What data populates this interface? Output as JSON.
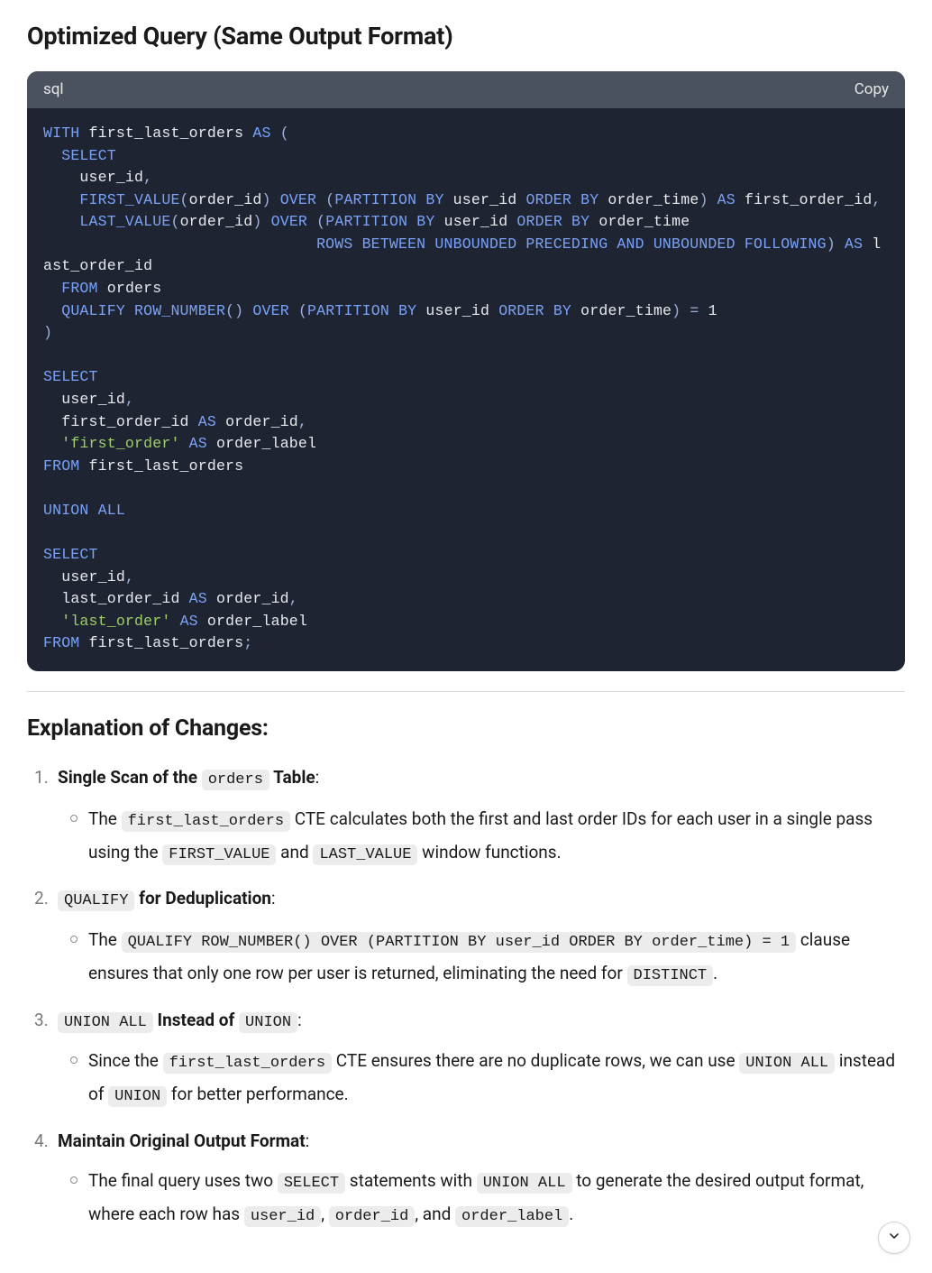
{
  "section_title": "Optimized Query (Same Output Format)",
  "code": {
    "language": "sql",
    "copy_label": "Copy",
    "tokens": [
      [
        [
          "kw",
          "WITH"
        ],
        [
          "id",
          " first_last_orders "
        ],
        [
          "kw",
          "AS"
        ],
        [
          "id",
          " "
        ],
        [
          "punc",
          "("
        ]
      ],
      [
        [
          "id",
          "  "
        ],
        [
          "kw",
          "SELECT"
        ]
      ],
      [
        [
          "id",
          "    user_id"
        ],
        [
          "punc",
          ","
        ]
      ],
      [
        [
          "id",
          "    "
        ],
        [
          "kw",
          "FIRST_VALUE"
        ],
        [
          "punc",
          "("
        ],
        [
          "id",
          "order_id"
        ],
        [
          "punc",
          ")"
        ],
        [
          "id",
          " "
        ],
        [
          "kw",
          "OVER"
        ],
        [
          "id",
          " "
        ],
        [
          "punc",
          "("
        ],
        [
          "kw",
          "PARTITION BY"
        ],
        [
          "id",
          " user_id "
        ],
        [
          "kw",
          "ORDER BY"
        ],
        [
          "id",
          " order_time"
        ],
        [
          "punc",
          ")"
        ],
        [
          "id",
          " "
        ],
        [
          "kw",
          "AS"
        ],
        [
          "id",
          " first_order_id"
        ],
        [
          "punc",
          ","
        ]
      ],
      [
        [
          "id",
          "    "
        ],
        [
          "kw",
          "LAST_VALUE"
        ],
        [
          "punc",
          "("
        ],
        [
          "id",
          "order_id"
        ],
        [
          "punc",
          ")"
        ],
        [
          "id",
          " "
        ],
        [
          "kw",
          "OVER"
        ],
        [
          "id",
          " "
        ],
        [
          "punc",
          "("
        ],
        [
          "kw",
          "PARTITION BY"
        ],
        [
          "id",
          " user_id "
        ],
        [
          "kw",
          "ORDER BY"
        ],
        [
          "id",
          " order_time"
        ]
      ],
      [
        [
          "id",
          "                              "
        ],
        [
          "kw",
          "ROWS BETWEEN UNBOUNDED PRECEDING AND UNBOUNDED FOLLOWING"
        ],
        [
          "punc",
          ")"
        ],
        [
          "id",
          " "
        ],
        [
          "kw",
          "AS"
        ],
        [
          "id",
          " last_order_id"
        ]
      ],
      [
        [
          "id",
          "  "
        ],
        [
          "kw",
          "FROM"
        ],
        [
          "id",
          " orders"
        ]
      ],
      [
        [
          "id",
          "  "
        ],
        [
          "kw",
          "QUALIFY"
        ],
        [
          "id",
          " "
        ],
        [
          "kw",
          "ROW_NUMBER"
        ],
        [
          "punc",
          "()"
        ],
        [
          "id",
          " "
        ],
        [
          "kw",
          "OVER"
        ],
        [
          "id",
          " "
        ],
        [
          "punc",
          "("
        ],
        [
          "kw",
          "PARTITION BY"
        ],
        [
          "id",
          " user_id "
        ],
        [
          "kw",
          "ORDER BY"
        ],
        [
          "id",
          " order_time"
        ],
        [
          "punc",
          ")"
        ],
        [
          "id",
          " "
        ],
        [
          "punc",
          "="
        ],
        [
          "id",
          " "
        ],
        [
          "num",
          "1"
        ]
      ],
      [
        [
          "punc",
          ")"
        ]
      ],
      [
        [
          "id",
          ""
        ]
      ],
      [
        [
          "kw",
          "SELECT"
        ]
      ],
      [
        [
          "id",
          "  user_id"
        ],
        [
          "punc",
          ","
        ]
      ],
      [
        [
          "id",
          "  first_order_id "
        ],
        [
          "kw",
          "AS"
        ],
        [
          "id",
          " order_id"
        ],
        [
          "punc",
          ","
        ]
      ],
      [
        [
          "id",
          "  "
        ],
        [
          "str",
          "'first_order'"
        ],
        [
          "id",
          " "
        ],
        [
          "kw",
          "AS"
        ],
        [
          "id",
          " order_label"
        ]
      ],
      [
        [
          "kw",
          "FROM"
        ],
        [
          "id",
          " first_last_orders"
        ]
      ],
      [
        [
          "id",
          ""
        ]
      ],
      [
        [
          "kw",
          "UNION ALL"
        ]
      ],
      [
        [
          "id",
          ""
        ]
      ],
      [
        [
          "kw",
          "SELECT"
        ]
      ],
      [
        [
          "id",
          "  user_id"
        ],
        [
          "punc",
          ","
        ]
      ],
      [
        [
          "id",
          "  last_order_id "
        ],
        [
          "kw",
          "AS "
        ],
        [
          "id",
          "order_id"
        ],
        [
          "punc",
          ","
        ]
      ],
      [
        [
          "id",
          "  "
        ],
        [
          "str",
          "'last_order'"
        ],
        [
          "id",
          " "
        ],
        [
          "kw",
          "AS"
        ],
        [
          "id",
          " order_label"
        ]
      ],
      [
        [
          "kw",
          "FROM"
        ],
        [
          "id",
          " first_last_orders"
        ],
        [
          "punc",
          ";"
        ]
      ]
    ]
  },
  "explanation_title": "Explanation of Changes:",
  "changes": [
    {
      "headline_parts": [
        {
          "kind": "bold",
          "text": "Single Scan of the "
        },
        {
          "kind": "code",
          "text": "orders"
        },
        {
          "kind": "bold",
          "text": " Table"
        },
        {
          "kind": "plain",
          "text": ":"
        }
      ],
      "bullets": [
        [
          {
            "kind": "plain",
            "text": "The "
          },
          {
            "kind": "code",
            "text": "first_last_orders"
          },
          {
            "kind": "plain",
            "text": " CTE calculates both the first and last order IDs for each user in a single pass using the "
          },
          {
            "kind": "code",
            "text": "FIRST_VALUE"
          },
          {
            "kind": "plain",
            "text": " and "
          },
          {
            "kind": "code",
            "text": "LAST_VALUE"
          },
          {
            "kind": "plain",
            "text": " window functions."
          }
        ]
      ]
    },
    {
      "headline_parts": [
        {
          "kind": "code",
          "text": "QUALIFY"
        },
        {
          "kind": "bold",
          "text": " for Deduplication"
        },
        {
          "kind": "plain",
          "text": ":"
        }
      ],
      "bullets": [
        [
          {
            "kind": "plain",
            "text": "The "
          },
          {
            "kind": "code",
            "text": "QUALIFY ROW_NUMBER() OVER (PARTITION BY user_id ORDER BY order_time) = 1"
          },
          {
            "kind": "plain",
            "text": " clause ensures that only one row per user is returned, eliminating the need for "
          },
          {
            "kind": "code",
            "text": "DISTINCT"
          },
          {
            "kind": "plain",
            "text": "."
          }
        ]
      ]
    },
    {
      "headline_parts": [
        {
          "kind": "code",
          "text": "UNION ALL"
        },
        {
          "kind": "bold",
          "text": " Instead of "
        },
        {
          "kind": "code",
          "text": "UNION"
        },
        {
          "kind": "plain",
          "text": ":"
        }
      ],
      "bullets": [
        [
          {
            "kind": "plain",
            "text": "Since the "
          },
          {
            "kind": "code",
            "text": "first_last_orders"
          },
          {
            "kind": "plain",
            "text": " CTE ensures there are no duplicate rows, we can use "
          },
          {
            "kind": "code",
            "text": "UNION ALL"
          },
          {
            "kind": "plain",
            "text": " instead of "
          },
          {
            "kind": "code",
            "text": "UNION"
          },
          {
            "kind": "plain",
            "text": " for better performance."
          }
        ]
      ]
    },
    {
      "headline_parts": [
        {
          "kind": "bold",
          "text": "Maintain Original Output Format"
        },
        {
          "kind": "plain",
          "text": ":"
        }
      ],
      "bullets": [
        [
          {
            "kind": "plain",
            "text": "The final query uses two "
          },
          {
            "kind": "code",
            "text": "SELECT"
          },
          {
            "kind": "plain",
            "text": " statements with "
          },
          {
            "kind": "code",
            "text": "UNION ALL"
          },
          {
            "kind": "plain",
            "text": " to generate the desired output format, where each row has "
          },
          {
            "kind": "code",
            "text": "user_id"
          },
          {
            "kind": "plain",
            "text": ", "
          },
          {
            "kind": "code",
            "text": "order_id"
          },
          {
            "kind": "plain",
            "text": ", and "
          },
          {
            "kind": "code",
            "text": "order_label"
          },
          {
            "kind": "plain",
            "text": "."
          }
        ]
      ]
    }
  ]
}
